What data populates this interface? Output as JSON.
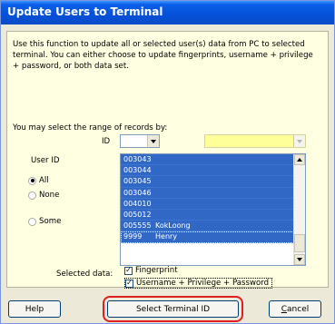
{
  "window": {
    "title": "Update Users to Terminal"
  },
  "description": "Use this function to update all or selected user(s) data from PC to selected terminal. You can either choose to update fingerprints, username + privilege + password, or both data set.",
  "range": {
    "label": "You may select the range of records by:",
    "id_label": "ID",
    "id_value": "",
    "range_value": ""
  },
  "userid": {
    "label": "User ID",
    "options": [
      {
        "label": "All",
        "checked": true
      },
      {
        "label": "None",
        "checked": false
      },
      {
        "label": "Some",
        "checked": false
      }
    ]
  },
  "users": [
    {
      "id": "003043",
      "name": ""
    },
    {
      "id": "003044",
      "name": ""
    },
    {
      "id": "003045",
      "name": ""
    },
    {
      "id": "003046",
      "name": ""
    },
    {
      "id": "004010",
      "name": ""
    },
    {
      "id": "005012",
      "name": ""
    },
    {
      "id": "005555",
      "name": "KokLoong"
    },
    {
      "id": "9999",
      "name": "Henry"
    }
  ],
  "selected_data": {
    "label": "Selected data:",
    "fingerprint": {
      "label": "Fingerprint",
      "checked": true
    },
    "username": {
      "label": "Username + Privilege + Password",
      "checked": true
    }
  },
  "buttons": {
    "help": "Help",
    "select": "Select Terminal ID",
    "cancel_prefix": "C",
    "cancel_rest": "ancel"
  }
}
